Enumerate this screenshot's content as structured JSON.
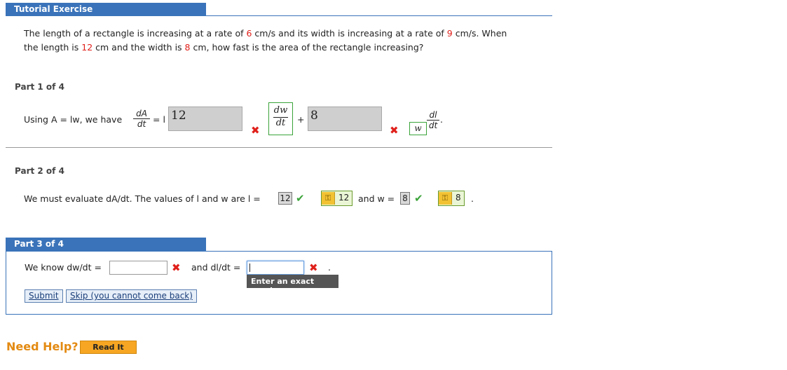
{
  "header": {
    "title": "Tutorial Exercise"
  },
  "problem": {
    "p1": "The length of a rectangle is increasing at a rate of ",
    "v1": "6",
    "p2": " cm/s and its width is increasing at a rate of ",
    "v2": "9",
    "p3": " cm/s. When",
    "p4": "the length is ",
    "v3": "12",
    "p5": " cm and the width is ",
    "v4": "8",
    "p6": " cm, how fast is the area of the rectangle increasing?"
  },
  "part1": {
    "label": "Part 1 of 4",
    "intro": "Using A = lw, we have",
    "dA": "dA",
    "dt": "dt",
    "eq_l": "= l",
    "box1": "12",
    "dw": "dw",
    "plus": "+",
    "box2": "8",
    "w": "w",
    "dl": "dl",
    "period": "."
  },
  "part2": {
    "label": "Part 2 of 4",
    "text": "We must evaluate dA/dt. The values of l and w are l =",
    "l_value": "12",
    "l_key_value": "12",
    "and_w": "and w =",
    "w_value": "8",
    "w_key_value": "8",
    "period": "."
  },
  "part3": {
    "label": "Part 3 of 4",
    "know": "We know dw/dt =",
    "and_dl": "and dl/dt =",
    "period": ".",
    "tooltip": "Enter an exact number.",
    "submit": "Submit",
    "skip": "Skip (you cannot come back)"
  },
  "help": {
    "label": "Need Help?",
    "read_it": "Read It"
  },
  "colors": {
    "accent": "#3a73b9",
    "error": "#e0201b",
    "correct": "#3aa33a",
    "help": "#e38a12"
  }
}
